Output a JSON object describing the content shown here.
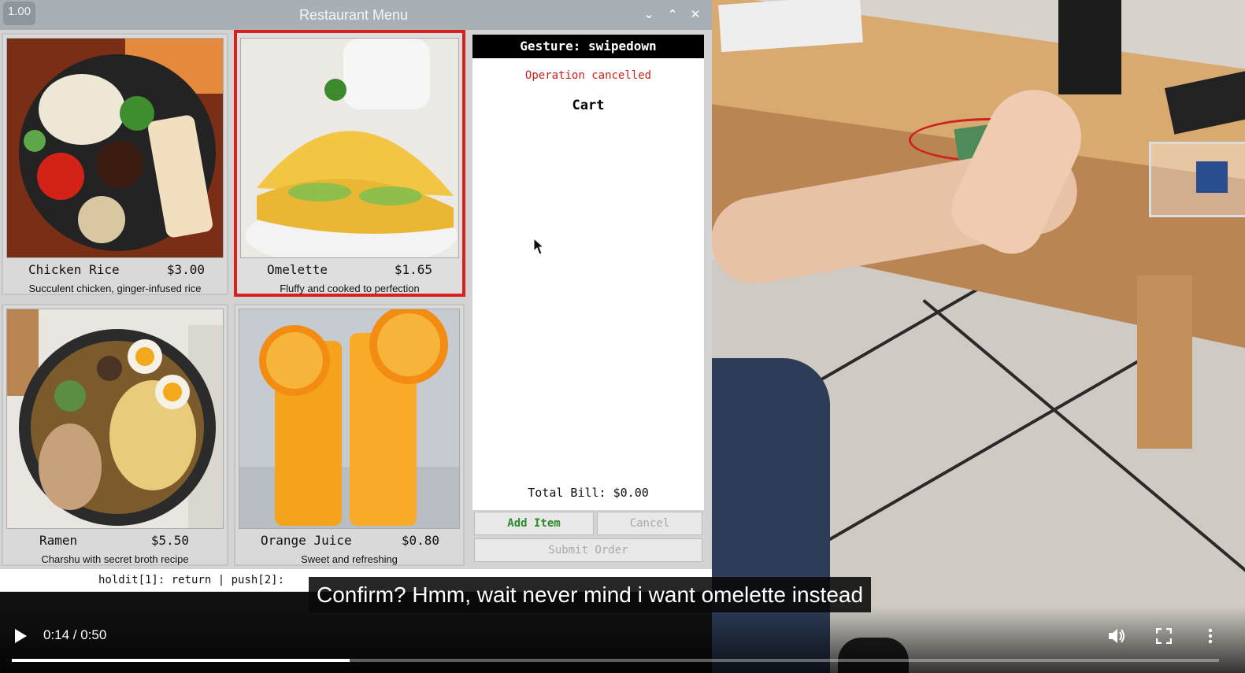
{
  "window": {
    "title": "Restaurant Menu",
    "version_badge": "1.00",
    "controls": {
      "minimize": "⌄",
      "maximize": "⌃",
      "close": "✕"
    }
  },
  "menu_items": [
    {
      "name": "Chicken Rice",
      "price": "$3.00",
      "description": "Succulent chicken, ginger-infused rice",
      "selected": false
    },
    {
      "name": "Omelette",
      "price": "$1.65",
      "description": "Fluffy and cooked to perfection",
      "selected": true
    },
    {
      "name": "Ramen",
      "price": "$5.50",
      "description": "Charshu with secret broth recipe",
      "selected": false
    },
    {
      "name": "Orange Juice",
      "price": "$0.80",
      "description": "Sweet and refreshing",
      "selected": false
    }
  ],
  "panel": {
    "gesture_label": "Gesture: swipedown",
    "status_message": "Operation cancelled",
    "cart_title": "Cart",
    "total_bill": "Total Bill: $0.00",
    "buttons": {
      "add_item": "Add Item",
      "cancel": "Cancel",
      "submit_order": "Submit Order"
    }
  },
  "hint_bar": "holdit[1]: return  |  push[2]:",
  "subtitle": "Confirm? Hmm, wait never mind i want omelette instead",
  "player": {
    "time_display": "0:14 / 0:50",
    "progress_fraction": 0.28,
    "icons": {
      "play": "play-icon",
      "volume": "volume-icon",
      "fullscreen": "fullscreen-icon",
      "more": "more-vert-icon"
    }
  },
  "colors": {
    "selection_border": "#d8211d",
    "status_red": "#c8201c",
    "add_green": "#2d8a2d"
  }
}
